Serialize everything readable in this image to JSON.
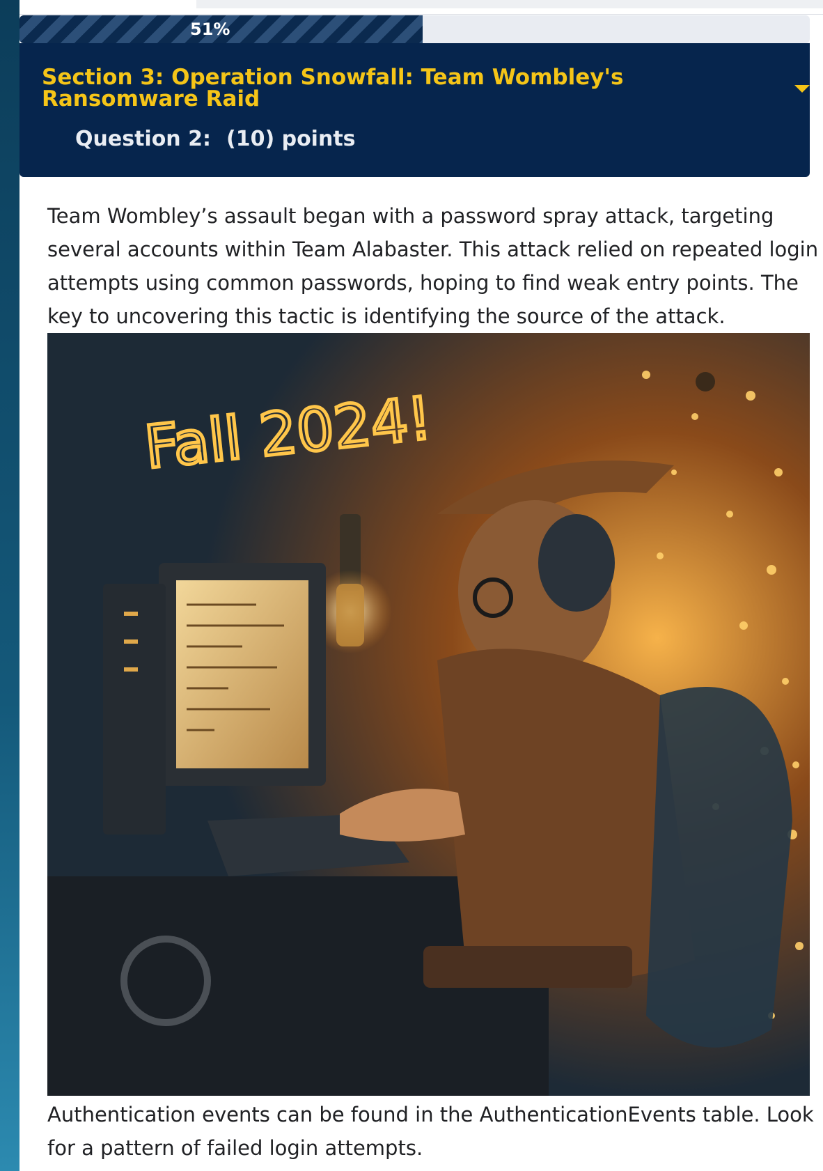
{
  "progress": {
    "percent_label": "51%",
    "fraction": 0.51
  },
  "section": {
    "title": "Section 3: Operation Snowfall: Team Wombley's Ransomware Raid",
    "question_label": "Question 2:",
    "points_label": "(10) points"
  },
  "content": {
    "intro": "Team Wombley’s assault began with a password spray attack, targeting several accounts within Team Alabaster. This attack relied on repeated login attempts using common passwords, hoping to find weak entry points. The key to uncovering this tactic is identifying the source of the attack.",
    "image_caption_text": "Fall 2024!",
    "hint": "Authentication events can be found in the AuthenticationEvents table. Look for a pattern of failed login attempts."
  },
  "colors": {
    "header_bg": "#06254d",
    "title_yellow": "#f5c518",
    "progress_stripe_dark": "#0b2a4f",
    "progress_track": "#e9ecf2"
  },
  "icons": {
    "section_toggle": "caret-down-icon"
  }
}
